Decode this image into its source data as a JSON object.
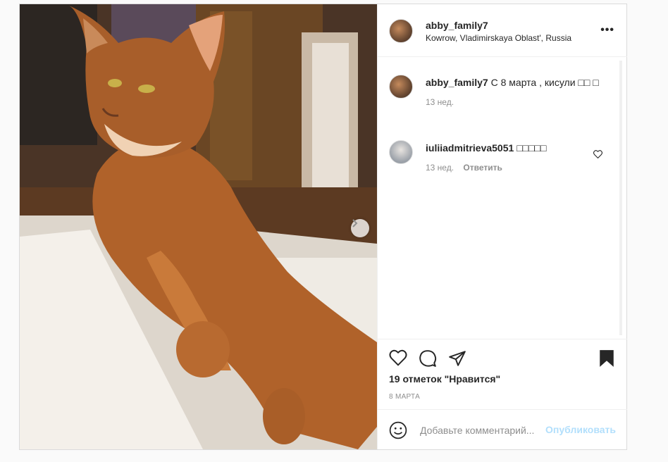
{
  "post": {
    "author": {
      "username": "abby_family7",
      "location": "Kowrow, Vladimirskaya Oblast', Russia"
    },
    "more_label": "•••",
    "caption": {
      "username": "abby_family7",
      "text": "С 8 марта , кисули □□ □",
      "time": "13 нед."
    },
    "comments": [
      {
        "username": "iuliiadmitrieva5051",
        "text": "□□□□□",
        "time": "13 нед.",
        "reply_label": "Ответить"
      }
    ],
    "likes_text": "19 отметок \"Нравится\"",
    "date_text": "8 МАРТА",
    "comment_placeholder": "Добавьте комментарий...",
    "publish_label": "Опубликовать",
    "icons": {
      "more": "more-horizontal-icon",
      "like": "heart-icon",
      "comment": "comment-bubble-icon",
      "share": "paper-plane-icon",
      "save": "bookmark-icon",
      "emoji": "emoji-icon",
      "next": "chevron-right-icon",
      "comment_like": "small-heart-icon"
    },
    "colors": {
      "publish_disabled": "#b2dffc",
      "meta_gray": "#8e8e8e",
      "border": "#dbdbdb"
    }
  }
}
